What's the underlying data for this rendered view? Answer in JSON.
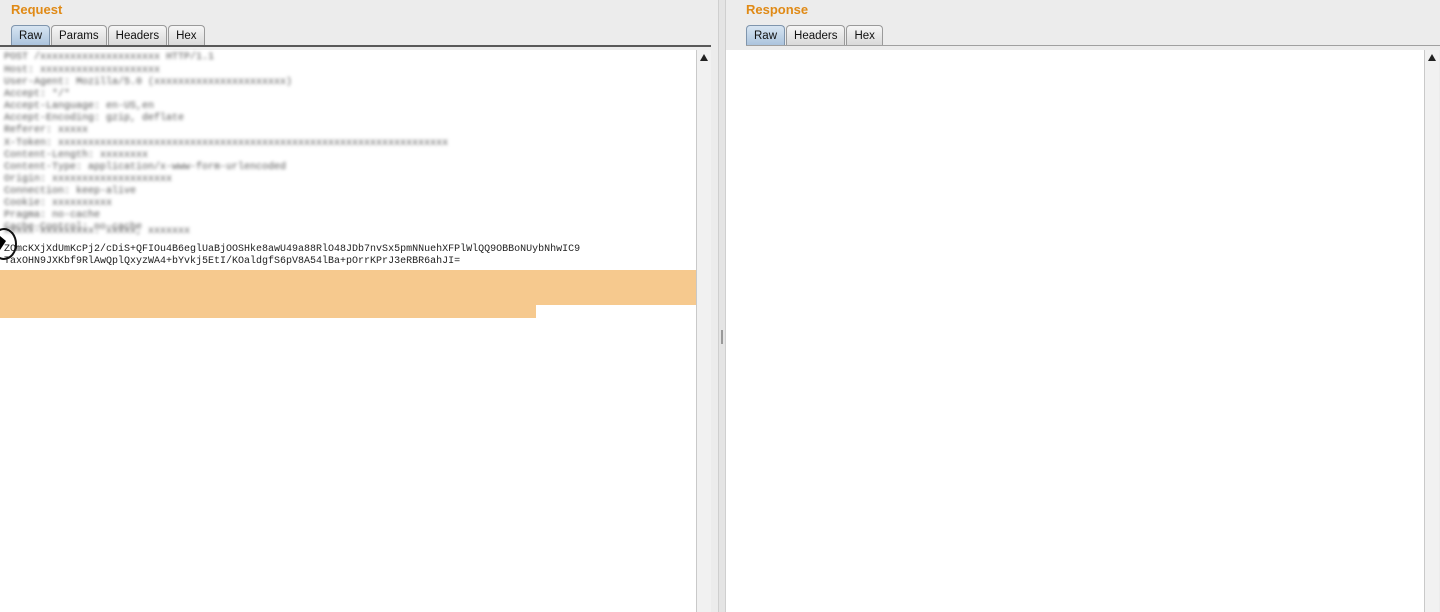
{
  "request": {
    "title": "Request",
    "tabs": [
      {
        "label": "Raw",
        "active": true
      },
      {
        "label": "Params",
        "active": false
      },
      {
        "label": "Headers",
        "active": false
      },
      {
        "label": "Hex",
        "active": false
      }
    ],
    "blurred_lines": [
      "POST /xxxxxxxxxxxxxxxxxxxx HTTP/1.1",
      "Host: xxxxxxxxxxxxxxxxxxxx",
      "User-Agent: Mozilla/5.0 (xxxxxxxxxxxxxxxxxxxxxx)",
      "Accept: */*",
      "Accept-Language: en-US,en",
      "Accept-Encoding: gzip, deflate",
      "Referer: xxxxx",
      "X-Token: xxxxxxxxxxxxxxxxxxxxxxxxxxxxxxxxxxxxxxxxxxxxxxxxxxxxxxxxxxxxxxxxx",
      "Content-Length: xxxxxxxx",
      "Content-Type: application/x-www-form-urlencoded",
      "Origin: xxxxxxxxxxxxxxxxxxxx",
      "Connection: keep-alive",
      "Cookie: xxxxxxxxxx",
      "Pragma: no-cache",
      "Cache-Control: no-cache"
    ],
    "highlighted_blurred_line": "Xxxxx-xxxxxxxxx: xxxxx, xxxxxxx",
    "body_line_1": "ZOmcKXjXdUmKcPj2/cDiS+QFIOu4B6eglUaBjOOSHke8awU49a88RlO48JDb7nvSx5pmNNuehXFPlWlQQ9OBBoNUybNhwIC9",
    "body_line_2": "TaxOHN9JXKbf9RlAwQplQxyzWA4+bYvkj5EtI/KOaldgfS6pV8A54lBa+pOrrKPrJ3eRBR6ahJI="
  },
  "response": {
    "title": "Response",
    "tabs": [
      {
        "label": "Raw",
        "active": true
      },
      {
        "label": "Headers",
        "active": false
      },
      {
        "label": "Hex",
        "active": false
      }
    ]
  }
}
